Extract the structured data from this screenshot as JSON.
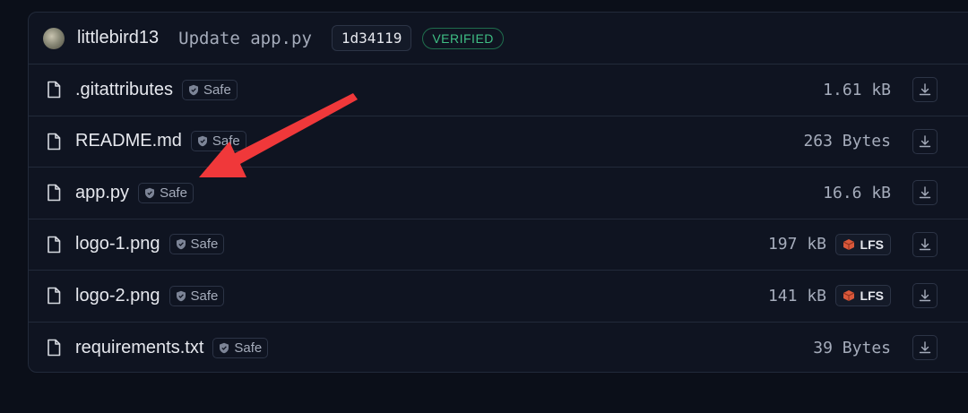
{
  "commit": {
    "author": "littlebird13",
    "message": "Update app.py",
    "hash": "1d34119",
    "status": "VERIFIED"
  },
  "files": [
    {
      "name": ".gitattributes",
      "badge": "Safe",
      "size": "1.61 kB",
      "lfs": false
    },
    {
      "name": "README.md",
      "badge": "Safe",
      "size": "263 Bytes",
      "lfs": false
    },
    {
      "name": "app.py",
      "badge": "Safe",
      "size": "16.6 kB",
      "lfs": false
    },
    {
      "name": "logo-1.png",
      "badge": "Safe",
      "size": "197 kB",
      "lfs": true,
      "lfs_label": "LFS"
    },
    {
      "name": "logo-2.png",
      "badge": "Safe",
      "size": "141 kB",
      "lfs": true,
      "lfs_label": "LFS"
    },
    {
      "name": "requirements.txt",
      "badge": "Safe",
      "size": "39 Bytes",
      "lfs": false
    }
  ],
  "colors": {
    "background": "#0b0f19",
    "panel": "#0f1421",
    "verified": "#3fbf85",
    "annotation_arrow": "#f0383a",
    "lfs_icon": "#d9583b"
  },
  "icons": {
    "file": "file-icon",
    "safe": "shield-icon",
    "lfs": "lfs-cube-icon",
    "download": "download-icon"
  }
}
